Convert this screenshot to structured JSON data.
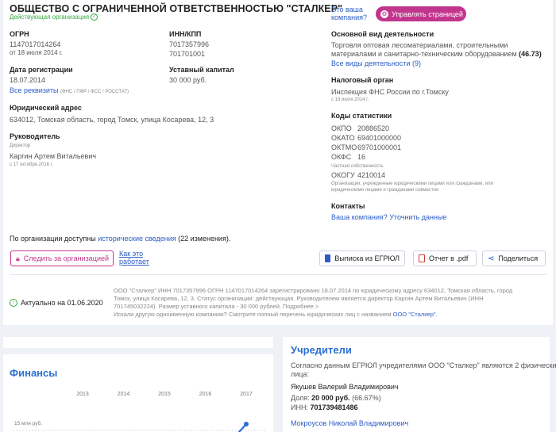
{
  "company": {
    "name": "ОБЩЕСТВО С ОГРАНИЧЕННОЙ ОТВЕТСТВЕННОСТЬЮ \"СТАЛКЕР\"",
    "status": "Действующая организация"
  },
  "owner_prompt": {
    "line1": "Это ваша",
    "line2": "компания?",
    "manage_label": "Управлять страницей"
  },
  "ogrn": {
    "label": "ОГРН",
    "value": "1147017014264",
    "date": "от 18 июля 2014 г."
  },
  "inn": {
    "label": "ИНН/КПП",
    "inn": "7017357996",
    "kpp": "701701001"
  },
  "registration": {
    "label": "Дата регистрации",
    "date": "18.07.2014",
    "link": "Все реквизиты",
    "funds": "(ФНС / ПФР / ФСС / РОССТАТ)"
  },
  "capital": {
    "label": "Уставный капитал",
    "value": "30 000 руб."
  },
  "address": {
    "label": "Юридический адрес",
    "value": "634012, Томская область, город Томск, улица Косарева, 12, 3"
  },
  "head": {
    "label": "Руководитель",
    "role": "Директор",
    "name": "Каргин Артем Витальевич",
    "since": "с 17 октября 2016 г."
  },
  "activity": {
    "label": "Основной вид деятельности",
    "line1": "Торговля оптовая лесоматериалами, строительными",
    "line2": "материалами и санитарно-техническим оборудованием",
    "code": "(46.73)",
    "all_link": "Все виды деятельности",
    "all_count": "(9)"
  },
  "tax": {
    "label": "Налоговый орган",
    "value": "Инспекция ФНС России по г.Томску",
    "since": "с 18 июля 2014 г."
  },
  "stat_codes": {
    "label": "Коды статистики",
    "items": [
      {
        "name": "ОКПО",
        "value": "20886520"
      },
      {
        "name": "ОКАТО",
        "value": "69401000000"
      },
      {
        "name": "ОКТМО",
        "value": "69701000001"
      },
      {
        "name": "ОКФС",
        "value": "16"
      }
    ],
    "okfs_note": "Частная собственность",
    "okogu_name": "ОКОГУ",
    "okogu_value": "4210014",
    "okogu_note1": "Организации, учрежденные юридическими лицами или гражданами, или",
    "okogu_note2": "юридическими лицами и гражданами совместно"
  },
  "contacts": {
    "label": "Контакты",
    "link": "Ваша компания? Уточнить данные"
  },
  "history": {
    "prefix": "По организации доступны",
    "link": "исторические сведения",
    "suffix": "(22 изменения)."
  },
  "actions": {
    "follow": "Следить за организацией",
    "how1": "Как это",
    "how2": "работает",
    "egrul": "Выписка из ЕГРЮЛ",
    "pdf": "Отчет в .pdf",
    "share": "Поделиться"
  },
  "actual": {
    "label": "Актуально на 01.06.2020"
  },
  "summary": {
    "line1": "ООО \"Сталкер\" ИНН 7017357996 ОГРН 1147017014264 зарегистрировано 18.07.2014 по юридическому адресу 634012, Томская область, город",
    "line2": "Томск, улица Косарева, 12, 3. Статус организации: действующая. Руководителем является директор Каргин Артем Витальевич (ИНН",
    "line3": "701745032224). Размер уставного капитала - 30 000 рублей. Подробнее >",
    "line4": "Искали другую одноименную компанию? Смотрите полный перечень юридических лиц с названием",
    "line4_link": "ООО \"Сталкер\"."
  },
  "finance": {
    "title": "Финансы",
    "y_tick": "15 млн руб."
  },
  "chart_data": {
    "type": "line",
    "title": "",
    "categories": [
      "2013",
      "2014",
      "2015",
      "2016",
      "2017"
    ],
    "ylabel": "",
    "y_ticks": [
      "15 млн руб."
    ],
    "series": [
      {
        "values": [
          null,
          null,
          null,
          null,
          15
        ]
      }
    ],
    "color": "#2c6fd1"
  },
  "founders": {
    "title": "Учредители",
    "intro1": "Согласно данным ЕГРЮЛ учредителями ООО \"Сталкер\" являются 2 физических",
    "intro2": "лица:",
    "f1_name": "Якушев Валерий Владимирович",
    "f1_share_label": "Доля:",
    "f1_share": "20 000 руб.",
    "f1_percent": "(66.67%)",
    "f1_inn_label": "ИНН:",
    "f1_inn": "701739481486",
    "f2_name": "Мокроусов Николай Владимирович"
  },
  "colors": {
    "accent": "#2c5cc5",
    "brand": "#c2358d",
    "active": "#3aa845"
  }
}
